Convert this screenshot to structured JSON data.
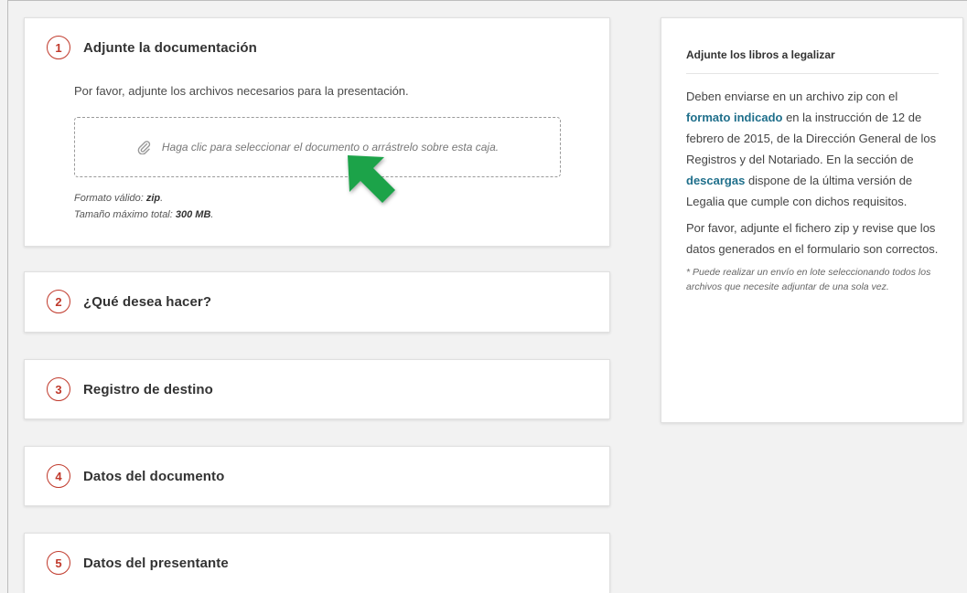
{
  "steps": [
    {
      "number": "1",
      "title": "Adjunte la documentación"
    },
    {
      "number": "2",
      "title": "¿Qué desea hacer?"
    },
    {
      "number": "3",
      "title": "Registro de destino"
    },
    {
      "number": "4",
      "title": "Datos del documento"
    },
    {
      "number": "5",
      "title": "Datos del presentante"
    }
  ],
  "upload": {
    "description": "Por favor, adjunte los archivos necesarios para la presentación.",
    "dropzone_text": "Haga clic para seleccionar el documento o arrástrelo sobre esta caja.",
    "format_label": "Formato válido: ",
    "format_value": "zip",
    "size_label": "Tamaño máximo total: ",
    "size_value": "300 MB"
  },
  "sidebar": {
    "title": "Adjunte los libros a legalizar",
    "para1_a": "Deben enviarse en un archivo zip con el ",
    "para1_link1": "formato indicado",
    "para1_b": " en la instrucción de 12 de febrero de 2015, de la Dirección General de los Registros y del Notariado. En la sección de ",
    "para1_link2": "descargas",
    "para1_c": " dispone de la última versión de Legalia que cumple con dichos requisitos.",
    "para2": "Por favor, adjunte el fichero zip y revise que los datos generados en el formulario son correctos.",
    "note": "* Puede realizar un envío en lote seleccionando todos los archivos que necesite adjuntar de una sola vez."
  },
  "colors": {
    "step_accent": "#c0392b",
    "link": "#1f6f8b",
    "arrow": "#1aa34a"
  },
  "icons": {
    "dropzone": "paperclip-icon",
    "pointer": "arrow-pointer-icon"
  }
}
